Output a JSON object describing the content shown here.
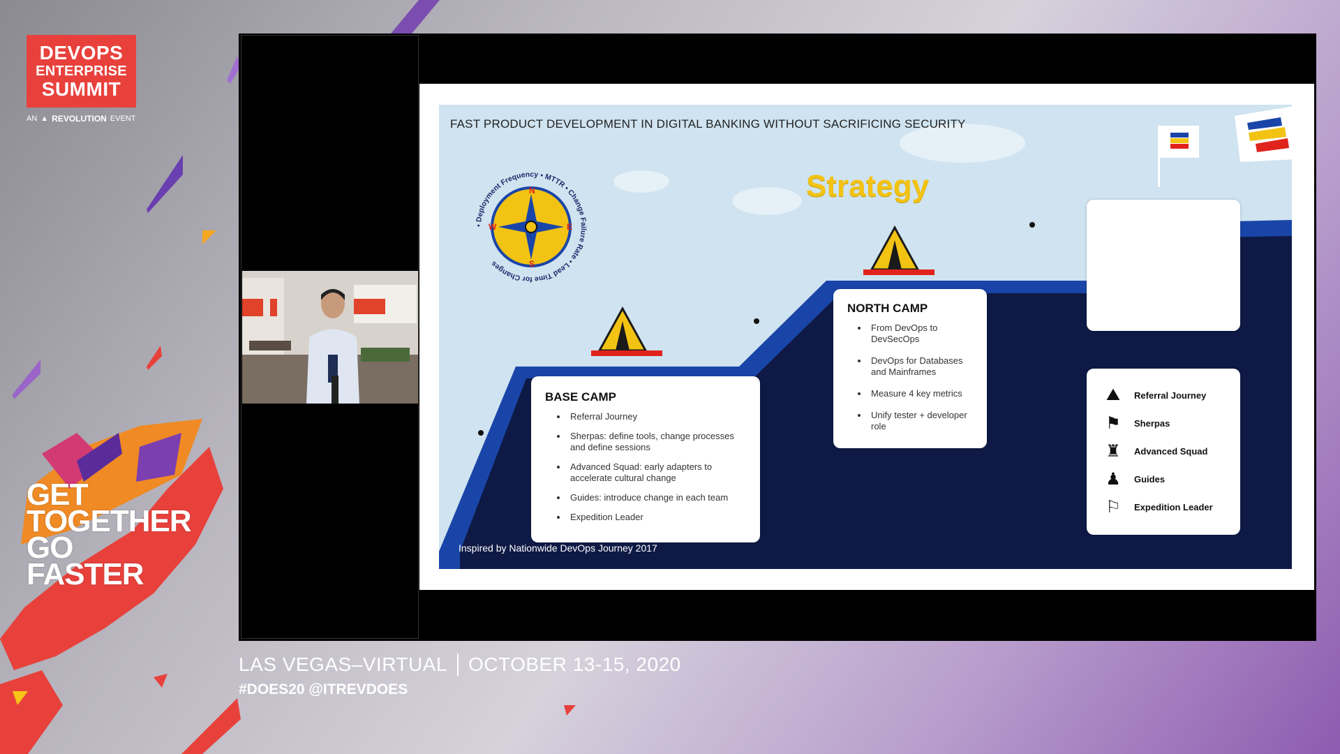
{
  "branding": {
    "logo_line1": "DEVOPS",
    "logo_line2": "ENTERPRISE",
    "logo_line3": "SUMMIT",
    "logo_sub_an": "AN",
    "logo_sub_brand": "REVOLUTION",
    "logo_sub_event": "EVENT",
    "tagline": [
      "GET",
      "TOGETHER",
      "GO",
      "FASTER"
    ],
    "accent_red": "#e8413c",
    "accent_purple": "#7b4db0"
  },
  "slide": {
    "title": "FAST PRODUCT DEVELOPMENT IN DIGITAL BANKING WITHOUT SACRIFICING SECURITY",
    "heading": "Strategy",
    "compass": {
      "ring_text": "• Deployment Frequency • MTTR • Change Failure Rate • Lead Time for Changes",
      "n": "N",
      "s": "S",
      "e": "E",
      "w": "W"
    },
    "base_camp": {
      "title": "BASE CAMP",
      "items": [
        "Referral Journey",
        "Sherpas: define tools, change processes and define sessions",
        "Advanced Squad: early adapters to accelerate cultural change",
        "Guides: introduce change in each team",
        "Expedition Leader"
      ]
    },
    "north_camp": {
      "title": "NORTH CAMP",
      "items": [
        "From DevOps to DevSecOps",
        "DevOps for Databases and Mainframes",
        "Measure 4 key metrics",
        "Unify tester + developer role"
      ]
    },
    "legend": [
      {
        "icon": "map-person-icon",
        "label": "Referral Journey"
      },
      {
        "icon": "sherpa-icon",
        "label": "Sherpas"
      },
      {
        "icon": "climber-icon",
        "label": "Advanced Squad"
      },
      {
        "icon": "guide-icon",
        "label": "Guides"
      },
      {
        "icon": "leader-icon",
        "label": "Expedition Leader"
      }
    ],
    "caption": "Inspired by Nationwide DevOps Journey 2017",
    "colors": {
      "sky": "#cfe3f0",
      "mountain_dark": "#0e1a45",
      "mountain_blue": "#1a45a8",
      "yellow": "#f2c313",
      "red": "#e0231c"
    }
  },
  "footer": {
    "location": "LAS VEGAS–VIRTUAL",
    "dates": "OCTOBER 13-15, 2020",
    "hashtags": "#DOES20  @ITREVDOES"
  }
}
